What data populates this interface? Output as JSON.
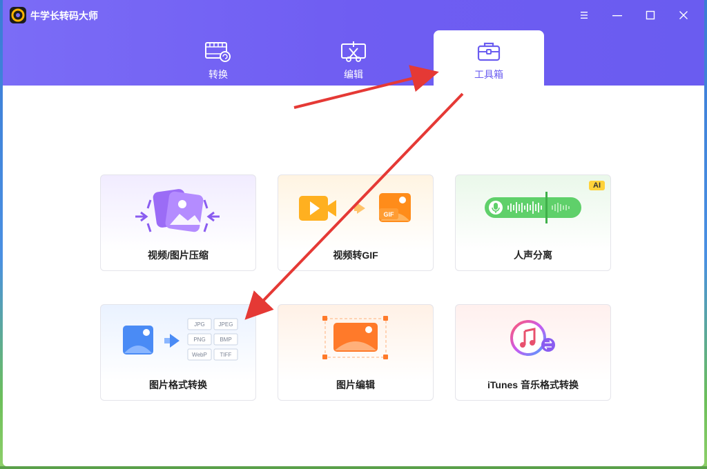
{
  "app": {
    "title": "牛学长转码大师",
    "logo_letter": "C"
  },
  "tabs": [
    {
      "label": "转换",
      "icon": "video-convert-icon",
      "active": false
    },
    {
      "label": "编辑",
      "icon": "scissors-edit-icon",
      "active": false
    },
    {
      "label": "工具箱",
      "icon": "toolbox-icon",
      "active": true
    }
  ],
  "tools": [
    {
      "label": "视频/图片压缩",
      "icon": "compress-icon"
    },
    {
      "label": "视频转GIF",
      "icon": "video-to-gif-icon",
      "illus_text": "GIF"
    },
    {
      "label": "人声分离",
      "icon": "voice-separation-icon",
      "badge": "AI"
    },
    {
      "label": "图片格式转换",
      "icon": "image-format-icon",
      "formats": [
        "JPG",
        "JPEG",
        "PNG",
        "BMP",
        "WebP",
        "TIFF"
      ]
    },
    {
      "label": "图片编辑",
      "icon": "image-edit-icon"
    },
    {
      "label": "iTunes 音乐格式转换",
      "icon": "itunes-convert-icon"
    }
  ],
  "colors": {
    "accent": "#6a5cf0",
    "arrow": "#e53935"
  }
}
